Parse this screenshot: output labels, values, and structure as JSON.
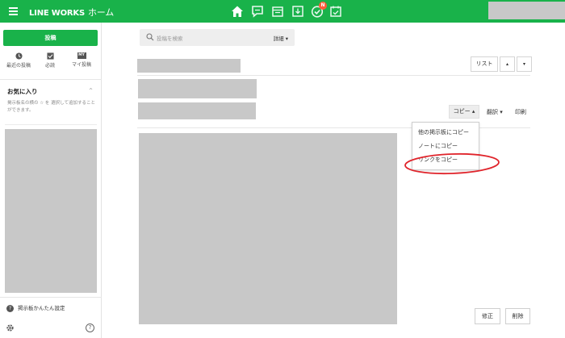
{
  "app": {
    "brand": "LINE WORKS",
    "home": "ホーム"
  },
  "nav_icons": [
    "home-icon",
    "chat-icon",
    "board-icon",
    "download-icon",
    "task-icon",
    "calendar-icon"
  ],
  "nav_badge": "N",
  "colors": {
    "brand_green": "#19b24a",
    "badge": "#ff5b3b",
    "placeholder_gray": "#c8c8c8",
    "annotation_red": "#e0242b"
  },
  "sidebar": {
    "post_button": "投稿",
    "quick": [
      {
        "label": "最近の投稿",
        "icon": "clock-icon"
      },
      {
        "label": "必読",
        "icon": "check-box-icon"
      },
      {
        "label": "マイ投稿",
        "icon": "my-icon",
        "icon_text": "MY"
      }
    ],
    "favorites": {
      "title": "お気に入り",
      "desc": "掲示板名の横の ☆ を 選択して追加することができます。"
    },
    "easy_setting": "掲示板かんたん設定",
    "help_glyph": "?"
  },
  "search": {
    "placeholder": "投稿を検索",
    "detail_label": "詳細 ▾"
  },
  "toolbar": {
    "list_label": "リスト",
    "up_glyph": "▴",
    "down_glyph": "▾",
    "copy_label": "コピー ▴",
    "translate_label": "翻訳 ▾",
    "print_label": "印刷"
  },
  "copy_menu": [
    "他の掲示板にコピー",
    "ノートにコピー",
    "リンクをコピー"
  ],
  "actions": {
    "edit": "修正",
    "delete": "削除"
  }
}
